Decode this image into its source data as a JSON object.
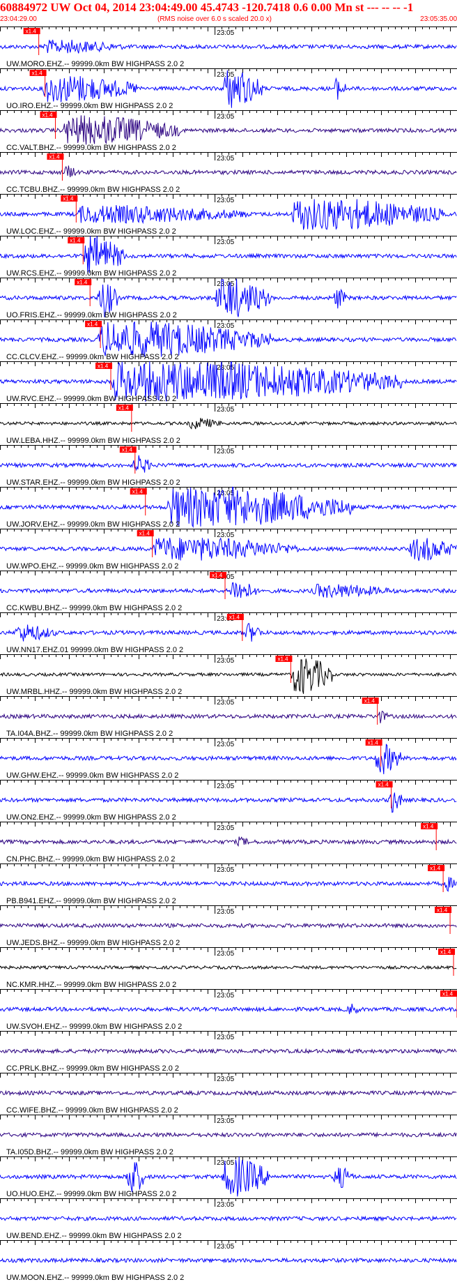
{
  "header": {
    "title": "60884972 UW Oct 04, 2014 23:04:49.00   45.4743 -120.7418  0.6 0.00 Mn st --- -- --  -1",
    "start_time": "23:04:29.00",
    "note": "(RMS noise over 6.0 s scaled 20.0 x)",
    "end_time": "23:05:35.00"
  },
  "chart_data": {
    "type": "line",
    "title": "60884972 UW Oct 04, 2014 23:04:49.00   45.4743 -120.7418  0.6 0.00 Mn st --- -- --  -1",
    "x_range": [
      "23:04:29.00",
      "23:05:35.00"
    ],
    "minute_tick_label": "23:05",
    "minute_tick_time": "23:05:00",
    "pick_label": "x1.4",
    "legend": "none",
    "colors": {
      "blue": "#0000ff",
      "black": "#000000",
      "purple": "#2a0080",
      "pick": "#ff0000"
    },
    "traces": [
      {
        "label": "UW.MORO.EHZ.-- 99999.0km BW  HIGHPASS  2.0  2",
        "color": "blue",
        "pick_time": "23:04:34.6",
        "activity": [
          {
            "start": "23:04:35",
            "end": "23:04:47",
            "amp": 0.35
          }
        ]
      },
      {
        "label": "UO.IRO.EHZ.-- 99999.0km BW  HIGHPASS  2.0  2",
        "color": "blue",
        "pick_time": "23:04:35.5",
        "activity": [
          {
            "start": "23:04:35",
            "end": "23:04:49",
            "amp": 0.7
          },
          {
            "start": "23:05:01",
            "end": "23:05:07",
            "amp": 1.0
          },
          {
            "start": "23:05:17",
            "end": "23:05:19",
            "amp": 0.6
          }
        ]
      },
      {
        "label": "CC.VALT.BHZ.-- 99999.0km BW  HIGHPASS  2.0  2",
        "color": "purple",
        "pick_time": "23:04:37.0",
        "activity": [
          {
            "start": "23:04:38",
            "end": "23:04:55",
            "amp": 0.75
          }
        ]
      },
      {
        "label": "CC.TCBU.BHZ.-- 99999.0km BW  HIGHPASS  2.0  2",
        "color": "purple",
        "pick_time": "23:04:38.0",
        "activity": [
          {
            "start": "23:04:38",
            "end": "23:04:40",
            "amp": 0.4
          }
        ]
      },
      {
        "label": "UW.LOC.EHZ.-- 99999.0km BW  HIGHPASS  2.0  2",
        "color": "blue",
        "pick_time": "23:04:40.0",
        "activity": [
          {
            "start": "23:04:40",
            "end": "23:05:05",
            "amp": 0.45
          },
          {
            "start": "23:05:11",
            "end": "23:05:33",
            "amp": 0.8
          }
        ]
      },
      {
        "label": "UW.RCS.EHZ.-- 99999.0km BW  HIGHPASS  2.0  2",
        "color": "blue",
        "pick_time": "23:04:41.0",
        "activity": [
          {
            "start": "23:04:41",
            "end": "23:04:47",
            "amp": 1.0
          }
        ]
      },
      {
        "label": "UO.FRIS.EHZ.-- 99999.0km BW  HIGHPASS  2.0  2",
        "color": "blue",
        "pick_time": "23:04:42.0",
        "activity": [
          {
            "start": "23:04:43",
            "end": "23:04:46",
            "amp": 1.0
          },
          {
            "start": "23:05:00",
            "end": "23:05:08",
            "amp": 1.0
          },
          {
            "start": "23:05:17",
            "end": "23:05:19",
            "amp": 0.6
          }
        ]
      },
      {
        "label": "CC.CLCV.EHZ.-- 99999.0km BW  HIGHPASS  2.0  2",
        "color": "blue",
        "pick_time": "23:04:43.5",
        "activity": [
          {
            "start": "23:04:43",
            "end": "23:05:08",
            "amp": 0.9
          }
        ]
      },
      {
        "label": "UW.RVC.EHZ.-- 99999.0km BW  HIGHPASS  2.0  2",
        "color": "blue",
        "pick_time": "23:04:45.0",
        "activity": [
          {
            "start": "23:04:45",
            "end": "23:05:27",
            "amp": 1.0
          }
        ]
      },
      {
        "label": "UW.LEBA.HHZ.-- 99999.0km BW  HIGHPASS  2.0  2",
        "color": "black",
        "pick_time": "23:04:48.0",
        "activity": [
          {
            "start": "23:04:56",
            "end": "23:05:01",
            "amp": 0.3
          }
        ]
      },
      {
        "label": "UW.STAR.EHZ.-- 99999.0km BW  HIGHPASS  2.0  2",
        "color": "blue",
        "pick_time": "23:04:48.5",
        "activity": [
          {
            "start": "23:04:48",
            "end": "23:04:51",
            "amp": 0.5
          }
        ]
      },
      {
        "label": "UW.JORV.EHZ.-- 99999.0km BW  HIGHPASS  2.0  2",
        "color": "blue",
        "pick_time": "23:04:50.0",
        "activity": [
          {
            "start": "23:04:53",
            "end": "23:05:20",
            "amp": 1.0
          }
        ]
      },
      {
        "label": "UW.WPO.EHZ.-- 99999.0km BW  HIGHPASS  2.0  2",
        "color": "blue",
        "pick_time": "23:04:51.0",
        "activity": [
          {
            "start": "23:04:51",
            "end": "23:05:12",
            "amp": 0.6
          },
          {
            "start": "23:05:28",
            "end": "23:05:35",
            "amp": 0.6
          }
        ]
      },
      {
        "label": "CC.KWBU.BHZ.-- 99999.0km BW  HIGHPASS  2.0  2",
        "color": "blue",
        "pick_time": "23:05:01.5",
        "activity": [
          {
            "start": "23:05:02",
            "end": "23:05:06",
            "amp": 0.6
          },
          {
            "start": "23:05:14",
            "end": "23:05:26",
            "amp": 0.35
          }
        ]
      },
      {
        "label": "UW.NN17.EHZ.01 99999.0km BW  HIGHPASS  2.0  2",
        "color": "blue",
        "pick_time": "23:05:04.0",
        "activity": [
          {
            "start": "23:04:31",
            "end": "23:04:37",
            "amp": 0.45
          },
          {
            "start": "23:05:04",
            "end": "23:05:07",
            "amp": 0.5
          }
        ]
      },
      {
        "label": "UW.MRBL.HHZ.-- 99999.0km BW  HIGHPASS  2.0  2",
        "color": "black",
        "pick_time": "23:05:11.0",
        "activity": [
          {
            "start": "23:05:11",
            "end": "23:05:17",
            "amp": 1.0
          }
        ]
      },
      {
        "label": "TA.I04A.BHZ.-- 99999.0km BW  HIGHPASS  2.0  2",
        "color": "purple",
        "pick_time": "23:05:23.5",
        "activity": [
          {
            "start": "23:05:23",
            "end": "23:05:25",
            "amp": 0.4
          }
        ]
      },
      {
        "label": "UW.GHW.EHZ.-- 99999.0km BW  HIGHPASS  2.0  2",
        "color": "blue",
        "pick_time": "23:05:24.0",
        "activity": [
          {
            "start": "23:05:23",
            "end": "23:05:27",
            "amp": 0.8
          }
        ]
      },
      {
        "label": "UW.ON2.EHZ.-- 99999.0km BW  HIGHPASS  2.0  2",
        "color": "blue",
        "pick_time": "23:05:25.5",
        "activity": [
          {
            "start": "23:05:25",
            "end": "23:05:27",
            "amp": 0.7
          }
        ]
      },
      {
        "label": "CN.PHC.BHZ.-- 99999.0km BW  HIGHPASS  2.0  2",
        "color": "purple",
        "pick_time": "23:05:32.0",
        "activity": [
          {
            "start": "23:05:03",
            "end": "23:05:05",
            "amp": 0.3
          }
        ]
      },
      {
        "label": "PB.B941.EHZ.-- 99999.0km BW  HIGHPASS  2.0  2",
        "color": "blue",
        "pick_time": "23:05:33.0",
        "activity": [
          {
            "start": "23:05:33",
            "end": "23:05:35",
            "amp": 0.4
          }
        ]
      },
      {
        "label": "UW.JEDS.BHZ.-- 99999.0km BW  HIGHPASS  2.0  2",
        "color": "purple",
        "pick_time": "23:05:34.0",
        "activity": []
      },
      {
        "label": "NC.KMR.HHZ.-- 99999.0km BW  HIGHPASS  2.0  2",
        "color": "black",
        "pick_time": "23:05:34.5",
        "activity": []
      },
      {
        "label": "UW.SVOH.EHZ.-- 99999.0km BW  HIGHPASS  2.0  2",
        "color": "blue",
        "pick_time": "23:05:35.0",
        "activity": [
          {
            "start": "23:05:19",
            "end": "23:05:21",
            "amp": 0.35
          }
        ]
      },
      {
        "label": "CC.PRLK.BHZ.-- 99999.0km BW  HIGHPASS  2.0  2",
        "color": "purple",
        "pick_time": null,
        "activity": []
      },
      {
        "label": "CC.WIFE.BHZ.-- 99999.0km BW  HIGHPASS  2.0  2",
        "color": "purple",
        "pick_time": null,
        "activity": []
      },
      {
        "label": "TA.I05D.BHZ.-- 99999.0km BW  HIGHPASS  2.0  2",
        "color": "purple",
        "pick_time": null,
        "activity": []
      },
      {
        "label": "UO.HUO.EHZ.-- 99999.0km BW  HIGHPASS  2.0  2",
        "color": "blue",
        "pick_time": null,
        "activity": [
          {
            "start": "23:04:47",
            "end": "23:04:50",
            "amp": 1.0
          },
          {
            "start": "23:05:01",
            "end": "23:05:08",
            "amp": 1.0
          },
          {
            "start": "23:05:17",
            "end": "23:05:20",
            "amp": 0.6
          }
        ]
      },
      {
        "label": "UW.BEND.EHZ.-- 99999.0km BW  HIGHPASS  2.0  2",
        "color": "blue",
        "pick_time": null,
        "activity": []
      },
      {
        "label": "UW.MOON.EHZ.-- 99999.0km BW  HIGHPASS  2.0  2",
        "color": "blue",
        "pick_time": null,
        "activity": []
      }
    ]
  }
}
